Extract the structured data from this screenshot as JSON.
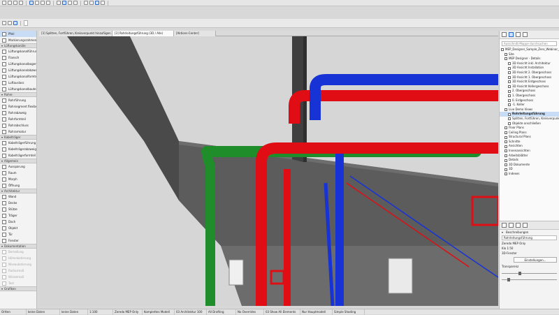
{
  "colors": {
    "red": "#e00e14",
    "green": "#1f8d2a",
    "blue": "#1733d6",
    "slab": "#5a5a5a",
    "column": "#444444"
  },
  "toolbar": {
    "row1_icons": [
      "open-icon",
      "save-icon",
      "undo-icon",
      "redo-icon",
      "pointer-icon",
      "arrow-icon",
      "marquee-icon",
      "rotate-icon",
      "zoom-icon",
      "layer-icon",
      "grid-icon",
      "snap-icon",
      "pen-icon",
      "settings-icon",
      "render-icon",
      "help-icon"
    ],
    "row3_fields": [
      "",
      ""
    ]
  },
  "toolbox": {
    "items": [
      {
        "type": "tool",
        "label": "Pfeil",
        "state": "sel"
      },
      {
        "type": "tool",
        "label": "Markierungsrahmen"
      },
      {
        "type": "group",
        "label": "Lüftungskanäle"
      },
      {
        "type": "tool",
        "label": "Lüftungskanalführung"
      },
      {
        "type": "tool",
        "label": "Flansch"
      },
      {
        "type": "tool",
        "label": "Lüftungskanalbogen"
      },
      {
        "type": "tool",
        "label": "Lüftungskanalabzweig"
      },
      {
        "type": "tool",
        "label": "Lüftungskanalformteil"
      },
      {
        "type": "tool",
        "label": "Luftauslass"
      },
      {
        "type": "tool",
        "label": "Lüftungskanalbauteil"
      },
      {
        "type": "group",
        "label": "Rohre"
      },
      {
        "type": "tool",
        "label": "Rohrführung"
      },
      {
        "type": "tool",
        "label": "Rohrsegment flexibel"
      },
      {
        "type": "tool",
        "label": "Rohrabzweig"
      },
      {
        "type": "tool",
        "label": "Rohrformteil"
      },
      {
        "type": "tool",
        "label": "Rohrabschluss"
      },
      {
        "type": "tool",
        "label": "Rohrarmatur"
      },
      {
        "type": "group",
        "label": "Kabelträger"
      },
      {
        "type": "tool",
        "label": "Kabelträgerführung"
      },
      {
        "type": "tool",
        "label": "Kabelträgerabzweig"
      },
      {
        "type": "tool",
        "label": "Kabelträgerformteil"
      },
      {
        "type": "group",
        "label": "Allgemein"
      },
      {
        "type": "tool",
        "label": "Aussparung"
      },
      {
        "type": "tool",
        "label": "Raum"
      },
      {
        "type": "tool",
        "label": "Morph"
      },
      {
        "type": "tool",
        "label": "Öffnung"
      },
      {
        "type": "group",
        "label": "Architektur"
      },
      {
        "type": "tool",
        "label": "Wand"
      },
      {
        "type": "tool",
        "label": "Decke"
      },
      {
        "type": "tool",
        "label": "Stütze"
      },
      {
        "type": "tool",
        "label": "Träger"
      },
      {
        "type": "tool",
        "label": "Dach"
      },
      {
        "type": "tool",
        "label": "Objekt"
      },
      {
        "type": "tool",
        "label": "Tür"
      },
      {
        "type": "tool",
        "label": "Fenster"
      },
      {
        "type": "group",
        "label": "Dokumentation"
      },
      {
        "type": "tool",
        "label": "Bemaßung",
        "state": "dis"
      },
      {
        "type": "tool",
        "label": "Höhenkotierung",
        "state": "dis"
      },
      {
        "type": "tool",
        "label": "Niveaukotierung",
        "state": "dis"
      },
      {
        "type": "tool",
        "label": "Radiusmaß",
        "state": "dis"
      },
      {
        "type": "tool",
        "label": "Winkelmaß",
        "state": "dis"
      },
      {
        "type": "tool",
        "label": "Text",
        "state": "dis"
      },
      {
        "type": "group",
        "label": "Grafiken"
      }
    ]
  },
  "tabs": [
    {
      "label": "[3] Splitten, Fortführen, Kreisverpunkt hinzufügen ...",
      "active": false
    },
    {
      "label": "[3] Rohrleitungsführung (3D / Alle)",
      "active": true
    },
    {
      "label": "[Aktions-Center]",
      "active": false
    }
  ],
  "navigator": {
    "search_placeholder": "Ausschnitt-Mappe durchsuchen",
    "items": [
      {
        "label": "MEP_Designer_Sample_Zero_Webinar_MEP",
        "indent": 0
      },
      {
        "label": "Site",
        "indent": 1
      },
      {
        "label": "MEP Designer - Details",
        "indent": 1
      },
      {
        "label": "3D Ansicht inkl. Architektur",
        "indent": 2
      },
      {
        "label": "3D Ansicht Installation",
        "indent": 2
      },
      {
        "label": "3D Ansicht 2. Obergeschoss",
        "indent": 2
      },
      {
        "label": "3D Ansicht 1. Obergeschoss",
        "indent": 2
      },
      {
        "label": "3D Ansicht Erdgeschoss",
        "indent": 2
      },
      {
        "label": "3D Ansicht Kellergeschoss",
        "indent": 2
      },
      {
        "label": "2. Obergeschoss",
        "indent": 2
      },
      {
        "label": "1. Obergeschoss",
        "indent": 2
      },
      {
        "label": "0. Erdgeschoss",
        "indent": 2
      },
      {
        "label": "-1. Keller",
        "indent": 2
      },
      {
        "label": "Live Demo Views",
        "indent": 1
      },
      {
        "label": "Rohrleitungsführung",
        "indent": 2,
        "sel": true
      },
      {
        "label": "Splitten, Fortführen, Kreisverpunkt hinzu",
        "indent": 2
      },
      {
        "label": "Objekte anschließen",
        "indent": 2
      },
      {
        "label": "Floor Plans",
        "indent": 1
      },
      {
        "label": "Ceiling Plans",
        "indent": 1
      },
      {
        "label": "Structural Plans",
        "indent": 1
      },
      {
        "label": "Schnitte",
        "indent": 1
      },
      {
        "label": "Ansichten",
        "indent": 1
      },
      {
        "label": "Innenansichten",
        "indent": 1
      },
      {
        "label": "Arbeitsblätter",
        "indent": 1
      },
      {
        "label": "Details",
        "indent": 1
      },
      {
        "label": "3D Dokumente",
        "indent": 1
      },
      {
        "label": "3D",
        "indent": 1
      },
      {
        "label": "Indexes",
        "indent": 1
      }
    ]
  },
  "info": {
    "section": "Beschreibungen",
    "name_value": "Rohrleitungsführung",
    "rows": [
      "Zeredo MEP Only",
      "Klo 1:50",
      "3D-Fenster"
    ],
    "settings_button": "Einstellungen...",
    "transparency_label": "Transparenz"
  },
  "status": {
    "items": [
      "Ortten",
      "keine Daten",
      "keine Daten",
      "1:100",
      "Zeredo MEP Only",
      "Komplettes Modell",
      "03 Architektur 100",
      "All Drafting",
      "No Overrides",
      "03 Show All Elements",
      "Nur Hauptmodell",
      "Simple Shading"
    ]
  }
}
